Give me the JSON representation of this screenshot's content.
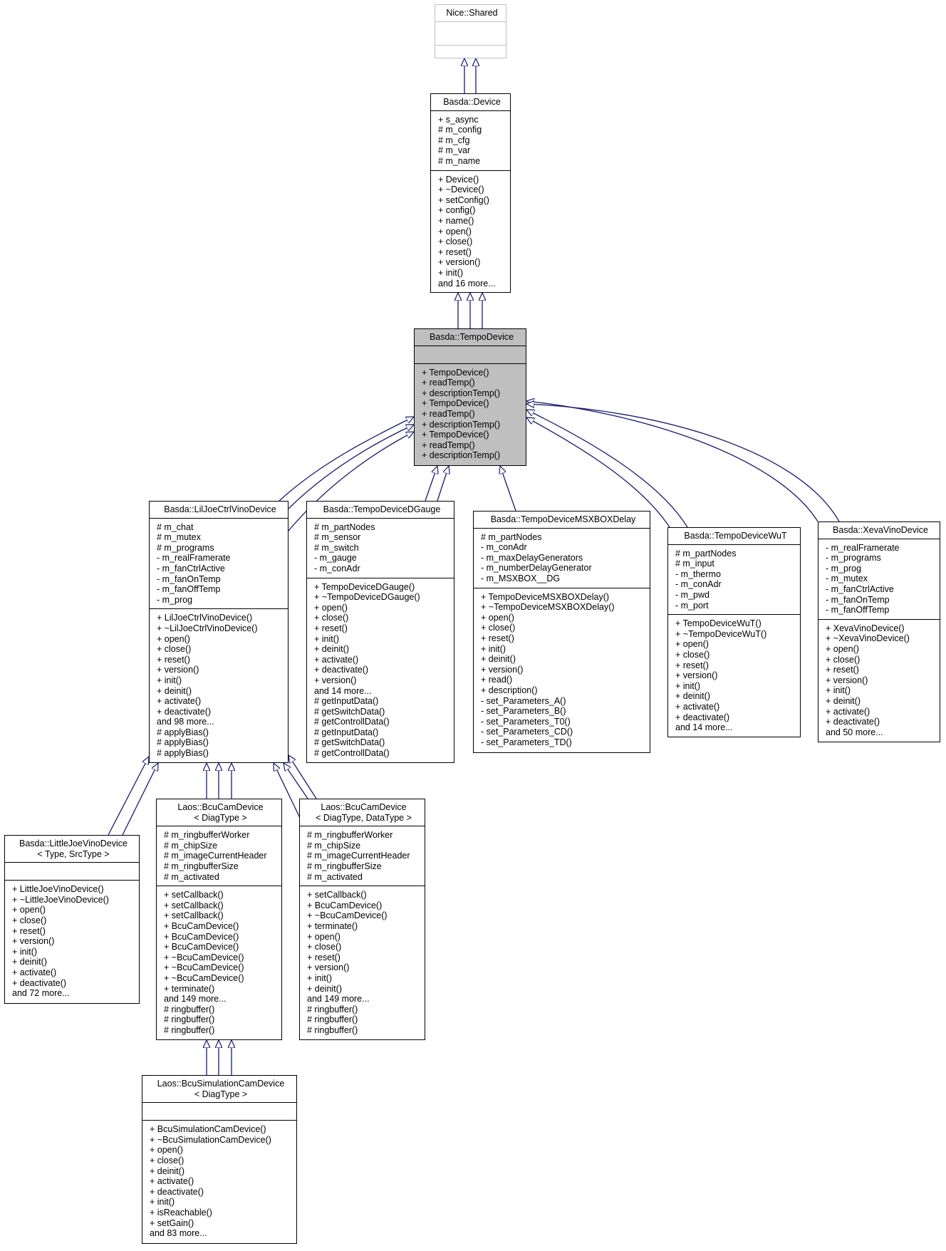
{
  "edge_color": "#191970",
  "current_class_fill": "#bfbfbf",
  "classes": [
    {
      "id": "shared",
      "name": "Nice::Shared",
      "attributes": [],
      "methods": []
    },
    {
      "id": "device",
      "name": "Basda::Device",
      "attributes": [
        "+ s_async",
        "# m_config",
        "# m_cfg",
        "# m_var",
        "# m_name"
      ],
      "methods": [
        "+ Device()",
        "+ ~Device()",
        "+ setConfig()",
        "+ config()",
        "+ name()",
        "+ open()",
        "+ close()",
        "+ reset()",
        "+ version()",
        "+ init()",
        "and 16 more..."
      ]
    },
    {
      "id": "tempo",
      "name": "Basda::TempoDevice",
      "attributes": [],
      "methods": [
        "+ TempoDevice()",
        "+ readTemp()",
        "+ descriptionTemp()",
        "+ TempoDevice()",
        "+ readTemp()",
        "+ descriptionTemp()",
        "+ TempoDevice()",
        "+ readTemp()",
        "+ descriptionTemp()"
      ]
    },
    {
      "id": "liljoe",
      "name": "Basda::LilJoeCtrlVinoDevice",
      "attributes": [
        "# m_chat",
        "# m_mutex",
        "# m_programs",
        "- m_realFramerate",
        "- m_fanCtrlActive",
        "- m_fanOnTemp",
        "- m_fanOffTemp",
        "- m_prog"
      ],
      "methods": [
        "+ LilJoeCtrlVinoDevice()",
        "+ ~LilJoeCtrlVinoDevice()",
        "+ open()",
        "+ close()",
        "+ reset()",
        "+ version()",
        "+ init()",
        "+ deinit()",
        "+ activate()",
        "+ deactivate()",
        "and 98 more...",
        "# applyBias()",
        "# applyBias()",
        "# applyBias()"
      ]
    },
    {
      "id": "dgauge",
      "name": "Basda::TempoDeviceDGauge",
      "attributes": [
        "# m_partNodes",
        "# m_sensor",
        "# m_switch",
        "- m_gauge",
        "- m_conAdr"
      ],
      "methods": [
        "+ TempoDeviceDGauge()",
        "+ ~TempoDeviceDGauge()",
        "+ open()",
        "+ close()",
        "+ reset()",
        "+ init()",
        "+ deinit()",
        "+ activate()",
        "+ deactivate()",
        "+ version()",
        "and 14 more...",
        "# getInputData()",
        "# getSwitchData()",
        "# getControllData()",
        "# getInputData()",
        "# getSwitchData()",
        "# getControllData()"
      ]
    },
    {
      "id": "msxbox",
      "name": "Basda::TempoDeviceMSXBOXDelay",
      "attributes": [
        "# m_partNodes",
        "- m_conAdr",
        "- m_maxDelayGenerators",
        "- m_numberDelayGenerator",
        "- m_MSXBOX__DG"
      ],
      "methods": [
        "+ TempoDeviceMSXBOXDelay()",
        "+ ~TempoDeviceMSXBOXDelay()",
        "+ open()",
        "+ close()",
        "+ reset()",
        "+ init()",
        "+ deinit()",
        "+ version()",
        "+ read()",
        "+ description()",
        "- set_Parameters_A()",
        "- set_Parameters_B()",
        "- set_Parameters_T0()",
        "- set_Parameters_CD()",
        "- set_Parameters_TD()"
      ]
    },
    {
      "id": "wut",
      "name": "Basda::TempoDeviceWuT",
      "attributes": [
        "# m_partNodes",
        "# m_input",
        "- m_thermo",
        "- m_conAdr",
        "- m_pwd",
        "- m_port"
      ],
      "methods": [
        "+ TempoDeviceWuT()",
        "+ ~TempoDeviceWuT()",
        "+ open()",
        "+ close()",
        "+ reset()",
        "+ version()",
        "+ init()",
        "+ deinit()",
        "+ activate()",
        "+ deactivate()",
        "and 14 more..."
      ]
    },
    {
      "id": "xeva",
      "name": "Basda::XevaVinoDevice",
      "attributes": [
        "- m_realFramerate",
        "- m_programs",
        "- m_prog",
        "- m_mutex",
        "- m_fanCtrlActive",
        "- m_fanOnTemp",
        "- m_fanOffTemp"
      ],
      "methods": [
        "+ XevaVinoDevice()",
        "+ ~XevaVinoDevice()",
        "+ open()",
        "+ close()",
        "+ reset()",
        "+ version()",
        "+ init()",
        "+ deinit()",
        "+ activate()",
        "+ deactivate()",
        "and 50 more..."
      ]
    },
    {
      "id": "littlejoe",
      "name": "Basda::LittleJoeVinoDevice\n< Type, SrcType >",
      "attributes": [],
      "methods": [
        "+ LittleJoeVinoDevice()",
        "+ ~LittleJoeVinoDevice()",
        "+ open()",
        "+ close()",
        "+ reset()",
        "+ version()",
        "+ init()",
        "+ deinit()",
        "+ activate()",
        "+ deactivate()",
        "and 72 more..."
      ]
    },
    {
      "id": "bcucam1",
      "name": "Laos::BcuCamDevice\n< DiagType >",
      "attributes": [
        "# m_ringbufferWorker",
        "# m_chipSize",
        "# m_imageCurrentHeader",
        "# m_ringbufferSize",
        "# m_activated"
      ],
      "methods": [
        "+ setCallback()",
        "+ setCallback()",
        "+ setCallback()",
        "+ BcuCamDevice()",
        "+ BcuCamDevice()",
        "+ BcuCamDevice()",
        "+ ~BcuCamDevice()",
        "+ ~BcuCamDevice()",
        "+ ~BcuCamDevice()",
        "+ terminate()",
        "and 149 more...",
        "# ringbuffer()",
        "# ringbuffer()",
        "# ringbuffer()"
      ]
    },
    {
      "id": "bcucam2",
      "name": "Laos::BcuCamDevice\n< DiagType, DataType >",
      "attributes": [
        "# m_ringbufferWorker",
        "# m_chipSize",
        "# m_imageCurrentHeader",
        "# m_ringbufferSize",
        "# m_activated"
      ],
      "methods": [
        "+ setCallback()",
        "+ BcuCamDevice()",
        "+ ~BcuCamDevice()",
        "+ terminate()",
        "+ open()",
        "+ close()",
        "+ reset()",
        "+ version()",
        "+ init()",
        "+ deinit()",
        "and 149 more...",
        "# ringbuffer()",
        "# ringbuffer()",
        "# ringbuffer()"
      ]
    },
    {
      "id": "bcusim",
      "name": "Laos::BcuSimulationCamDevice\n< DiagType >",
      "attributes": [],
      "methods": [
        "+ BcuSimulationCamDevice()",
        "+ ~BcuSimulationCamDevice()",
        "+ open()",
        "+ close()",
        "+ deinit()",
        "+ activate()",
        "+ deactivate()",
        "+ init()",
        "+ isReachable()",
        "+ setGain()",
        "and 83 more..."
      ]
    }
  ]
}
